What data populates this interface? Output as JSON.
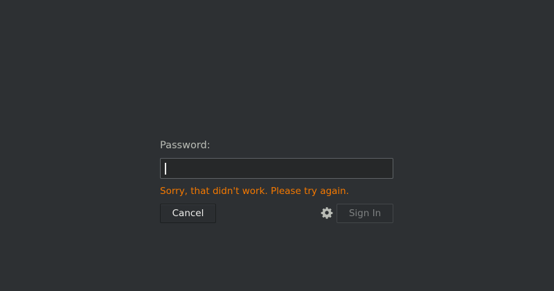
{
  "login": {
    "password_label": "Password:",
    "password_value": "",
    "error_message": "Sorry, that didn't work. Please try again.",
    "cancel_label": "Cancel",
    "sign_in_label": "Sign In",
    "settings_icon": "gear-icon"
  },
  "colors": {
    "background": "#2d3033",
    "error": "#f57900",
    "label": "#babdb6"
  }
}
